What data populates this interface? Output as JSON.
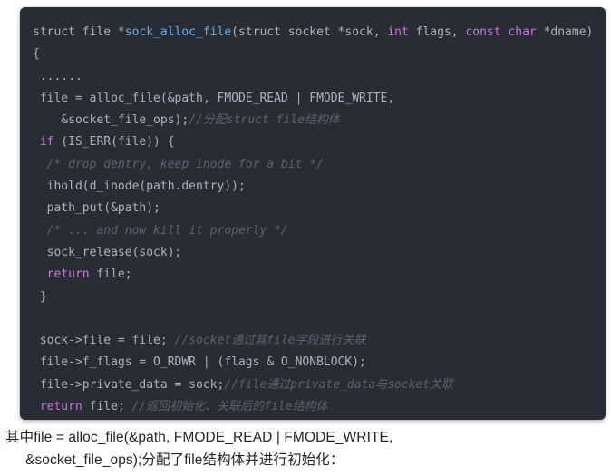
{
  "code_block": {
    "language": "c",
    "theme": {
      "background": "#282c34",
      "text": "#abb2bf",
      "keyword": "#c678dd",
      "function": "#61afef",
      "comment": "#5c6370"
    },
    "lines": [
      {
        "id": "line-1",
        "segments": [
          {
            "text": "struct file *",
            "kind": "text"
          },
          {
            "text": "sock_alloc_file",
            "kind": "function"
          },
          {
            "text": "(struct socket *sock, ",
            "kind": "text"
          },
          {
            "text": "int",
            "kind": "keyword"
          },
          {
            "text": " flags, ",
            "kind": "text"
          },
          {
            "text": "const",
            "kind": "keyword"
          },
          {
            "text": " ",
            "kind": "text"
          },
          {
            "text": "char",
            "kind": "keyword"
          },
          {
            "text": " *dname)",
            "kind": "text"
          }
        ]
      },
      {
        "id": "line-2",
        "segments": [
          {
            "text": "{",
            "kind": "text"
          }
        ]
      },
      {
        "id": "line-3",
        "segments": [
          {
            "text": " ......",
            "kind": "text"
          }
        ]
      },
      {
        "id": "line-4",
        "segments": [
          {
            "text": " file = alloc_file(&path, FMODE_READ | FMODE_WRITE,",
            "kind": "text"
          }
        ]
      },
      {
        "id": "line-5",
        "segments": [
          {
            "text": "    &socket_file_ops);",
            "kind": "text"
          },
          {
            "text": "//分配struct file结构体",
            "kind": "comment"
          }
        ]
      },
      {
        "id": "line-6",
        "segments": [
          {
            "text": " ",
            "kind": "text"
          },
          {
            "text": "if",
            "kind": "keyword"
          },
          {
            "text": " (IS_ERR(file)) {",
            "kind": "text"
          }
        ]
      },
      {
        "id": "line-7",
        "segments": [
          {
            "text": "  ",
            "kind": "text"
          },
          {
            "text": "/* drop dentry, keep inode for a bit */",
            "kind": "comment"
          }
        ]
      },
      {
        "id": "line-8",
        "segments": [
          {
            "text": "  ihold(d_inode(path.dentry));",
            "kind": "text"
          }
        ]
      },
      {
        "id": "line-9",
        "segments": [
          {
            "text": "  path_put(&path);",
            "kind": "text"
          }
        ]
      },
      {
        "id": "line-10",
        "segments": [
          {
            "text": "  ",
            "kind": "text"
          },
          {
            "text": "/* ... and now kill it properly */",
            "kind": "comment"
          }
        ]
      },
      {
        "id": "line-11",
        "segments": [
          {
            "text": "  sock_release(sock);",
            "kind": "text"
          }
        ]
      },
      {
        "id": "line-12",
        "segments": [
          {
            "text": "  ",
            "kind": "text"
          },
          {
            "text": "return",
            "kind": "keyword"
          },
          {
            "text": " file;",
            "kind": "text"
          }
        ]
      },
      {
        "id": "line-13",
        "segments": [
          {
            "text": " }",
            "kind": "text"
          }
        ]
      },
      {
        "id": "line-14",
        "segments": [
          {
            "text": "",
            "kind": "text"
          }
        ]
      },
      {
        "id": "line-15",
        "segments": [
          {
            "text": " sock->file = file; ",
            "kind": "text"
          },
          {
            "text": "//socket通过其file字段进行关联",
            "kind": "comment"
          }
        ]
      },
      {
        "id": "line-16",
        "segments": [
          {
            "text": " file->f_flags = O_RDWR | (flags & O_NONBLOCK);",
            "kind": "text"
          }
        ]
      },
      {
        "id": "line-17",
        "segments": [
          {
            "text": " file->private_data = sock;",
            "kind": "text"
          },
          {
            "text": "//file通过private_data与socket关联",
            "kind": "comment"
          }
        ]
      },
      {
        "id": "line-18",
        "segments": [
          {
            "text": " ",
            "kind": "text"
          },
          {
            "text": "return",
            "kind": "keyword"
          },
          {
            "text": " file; ",
            "kind": "text"
          },
          {
            "text": "//返回初始化、关联后的file结构体",
            "kind": "comment"
          }
        ]
      },
      {
        "id": "line-19",
        "segments": [
          {
            "text": "}",
            "kind": "text"
          }
        ]
      }
    ]
  },
  "caption": {
    "color": "#1f2329",
    "lines": [
      {
        "id": "caption-line-1",
        "text": "其中file = alloc_file(&path, FMODE_READ | FMODE_WRITE,",
        "indent": false
      },
      {
        "id": "caption-line-2",
        "text": "&socket_file_ops);分配了file结构体并进行初始化：",
        "indent": true
      }
    ]
  }
}
